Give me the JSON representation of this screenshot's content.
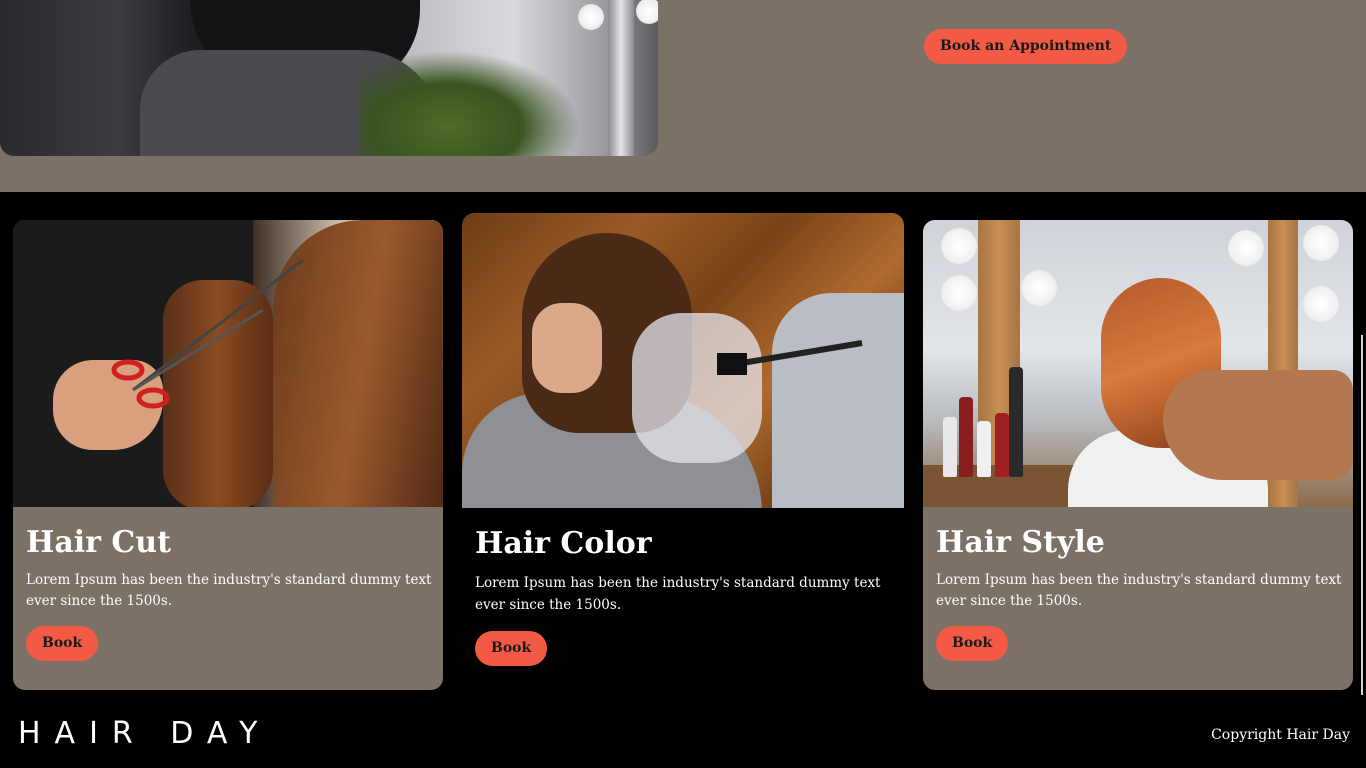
{
  "hero": {
    "cta_label": "Book an Appointment"
  },
  "services": [
    {
      "title": "Hair Cut",
      "description": "Lorem Ipsum has been the industry's standard dummy text ever since the 1500s.",
      "button_label": "Book",
      "card_color": "#7b7166"
    },
    {
      "title": "Hair Color",
      "description": "Lorem Ipsum has been the industry's standard dummy text ever since the 1500s.",
      "button_label": "Book",
      "card_color": "#000000"
    },
    {
      "title": "Hair Style",
      "description": "Lorem Ipsum has been the industry's standard dummy text ever since the 1500s.",
      "button_label": "Book",
      "card_color": "#7b7166"
    }
  ],
  "footer": {
    "logo": "HAIR DAY",
    "copyright": "Copyright Hair Day"
  },
  "colors": {
    "accent": "#f25a45",
    "taupe": "#7b7166",
    "background": "#000000"
  }
}
